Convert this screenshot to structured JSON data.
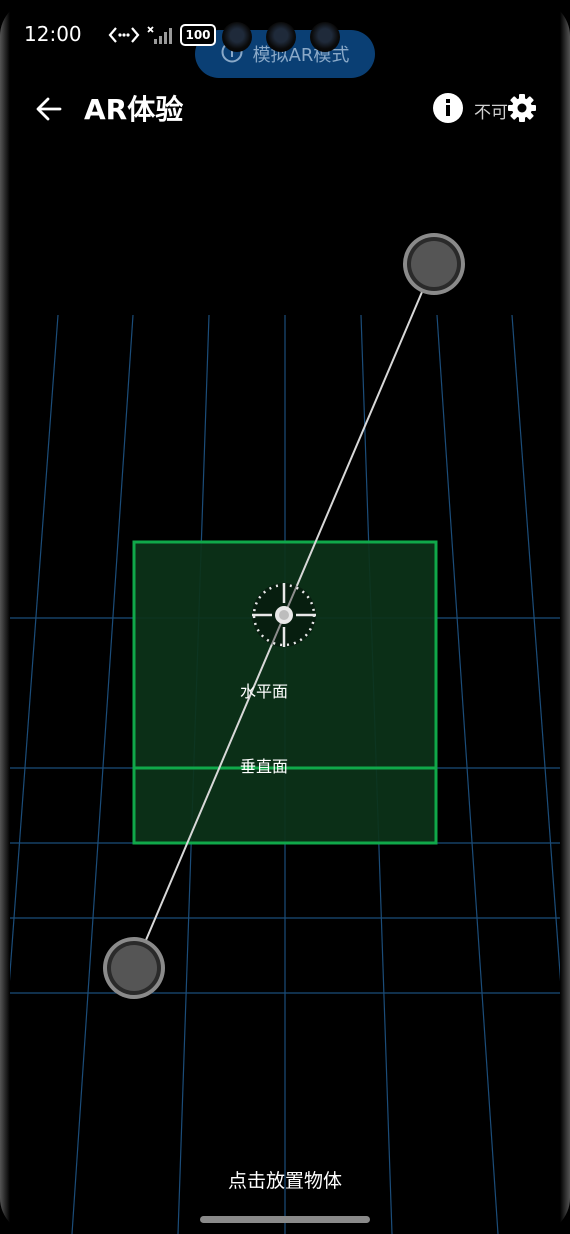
{
  "status_bar": {
    "time": "12:00",
    "battery": "100"
  },
  "mode_banner": {
    "label": "模拟AR模式"
  },
  "header": {
    "title": "AR体验",
    "status": "不可"
  },
  "scene": {
    "horizontal_plane_label": "水平面",
    "vertical_plane_label": "垂直面",
    "hint": "点击放置物体"
  },
  "colors": {
    "plane_fill": "#0c3319",
    "plane_border": "#10a84a",
    "grid": "#1b4d7a",
    "pill_bg": "#0a3f74"
  }
}
